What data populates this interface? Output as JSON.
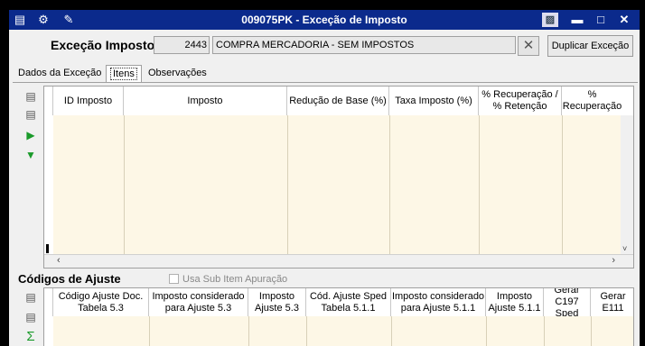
{
  "window": {
    "title": "009075PK - Exceção de Imposto",
    "colors": {
      "titlebar": "#0b2a8c",
      "grid_body": "#fdf7e6"
    }
  },
  "header": {
    "label": "Exceção Imposto",
    "code": "2443",
    "description": "COMPRA MERCADORIA - SEM IMPOSTOS",
    "duplicate_button": "Duplicar Exceção"
  },
  "tabs": [
    {
      "label": "Dados da Exceção",
      "active": false
    },
    {
      "label": "Itens",
      "active": true
    },
    {
      "label": "Observações",
      "active": false
    }
  ],
  "items_grid": {
    "columns": [
      "ID Imposto",
      "Imposto",
      "Redução de Base (%)",
      "Taxa Imposto (%)",
      "% Recuperação / % Retenção",
      "% Recuperação"
    ]
  },
  "ajuste": {
    "title": "Códigos de Ajuste",
    "checkbox_label": "Usa Sub Item Apuração",
    "columns": [
      "Código Ajuste Doc. Tabela 5.3",
      "Imposto considerado para Ajuste 5.3",
      "Imposto Ajuste 5.3",
      "Cód. Ajuste Sped Tabela 5.1.1",
      "Imposto considerado para Ajuste 5.1.1",
      "Imposto Ajuste 5.1.1",
      "Gerar C197 Sped",
      "Gerar E111"
    ]
  }
}
